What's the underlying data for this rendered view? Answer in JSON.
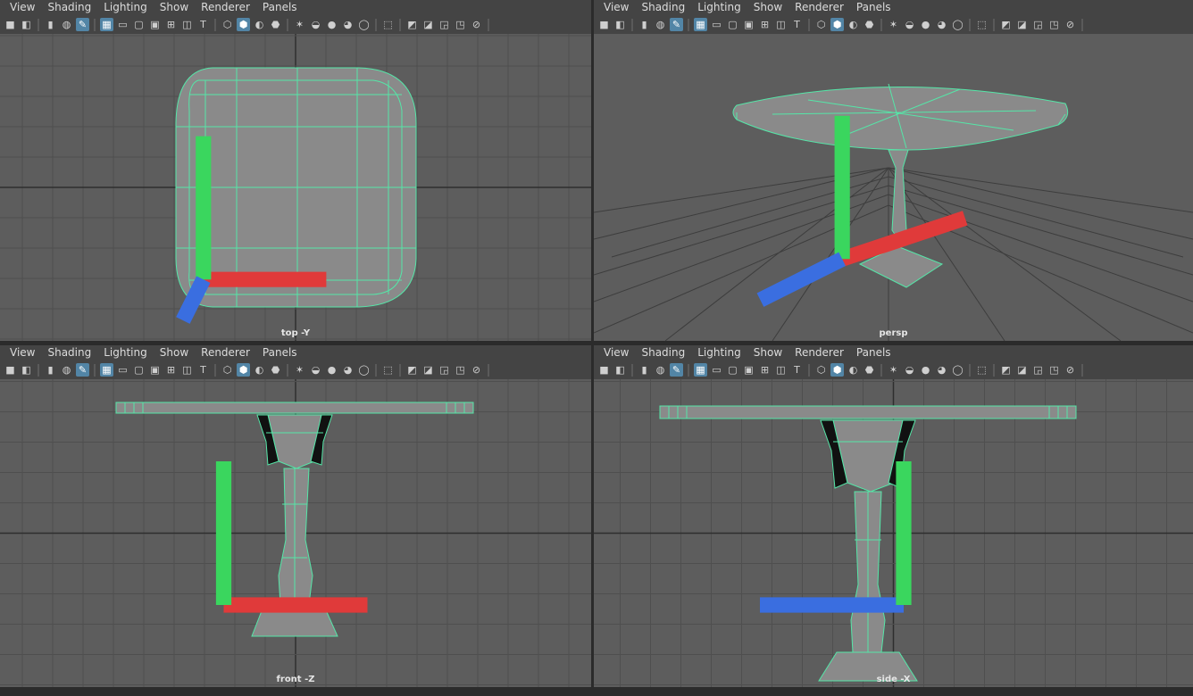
{
  "menu": [
    "View",
    "Shading",
    "Lighting",
    "Show",
    "Renderer",
    "Panels"
  ],
  "toolbar_icons": [
    "camera-icon",
    "camera-attr-icon",
    "bookmark-icon",
    "snapshot-icon",
    "pencil-icon",
    "grid-toggle-icon",
    "film-gate-icon",
    "resolution-gate-icon",
    "gate-mask-icon",
    "field-chart-icon",
    "safe-action-icon",
    "safe-title-icon",
    "wireframe-icon",
    "smooth-shade-icon",
    "shade-all-icon",
    "textured-icon",
    "lights-icon",
    "shadows-icon",
    "screen-ambient-occlusion-icon",
    "motion-blur-icon",
    "anti-aliasing-icon",
    "isolate-select-icon",
    "xray-icon",
    "xray-joints-icon",
    "xray-components-icon",
    "backface-icon",
    "hud-icon"
  ],
  "colors": {
    "wire": "#55e6a8",
    "grid": "#4f4f4f",
    "gridDark": "#2e2e2e",
    "viewport": "#5d5d5d",
    "highlight": "#5285a6",
    "axisX": "#e03a3a",
    "axisY": "#3ad65e",
    "axisZ": "#3a6ee0"
  },
  "panes": [
    {
      "id": "top",
      "camera": "top -Y",
      "axes": [
        "y",
        "x",
        "z"
      ]
    },
    {
      "id": "persp",
      "camera": "persp",
      "axes": [
        "y",
        "z",
        "x"
      ]
    },
    {
      "id": "front",
      "camera": "front -Z",
      "axes": [
        "y",
        "x"
      ]
    },
    {
      "id": "side",
      "camera": "side -X",
      "axes": [
        "y",
        "z"
      ]
    }
  ]
}
